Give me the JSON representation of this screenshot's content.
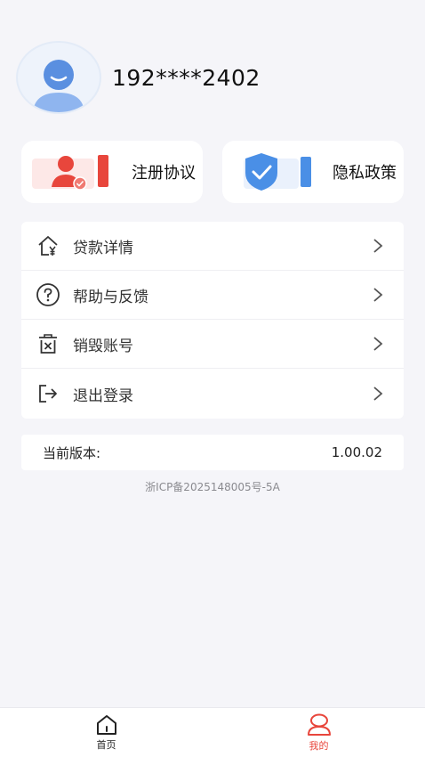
{
  "profile": {
    "phone": "192****2402"
  },
  "cards": [
    {
      "label": "注册协议",
      "icon": "user-doc-icon"
    },
    {
      "label": "隐私政策",
      "icon": "shield-check-icon"
    }
  ],
  "menu": [
    {
      "label": "贷款详情",
      "icon": "house-yen-icon"
    },
    {
      "label": "帮助与反馈",
      "icon": "question-circle-icon"
    },
    {
      "label": "销毁账号",
      "icon": "trash-icon"
    },
    {
      "label": "退出登录",
      "icon": "logout-icon"
    }
  ],
  "version": {
    "label": "当前版本:",
    "value": "1.00.02"
  },
  "icp": "浙ICP备2025148005号-5A",
  "tabs": [
    {
      "label": "首页",
      "icon": "home-icon",
      "active": false
    },
    {
      "label": "我的",
      "icon": "profile-icon",
      "active": true
    }
  ],
  "colors": {
    "accent": "#e8463c",
    "shield": "#4a8fe6",
    "background": "#f5f5f9"
  }
}
